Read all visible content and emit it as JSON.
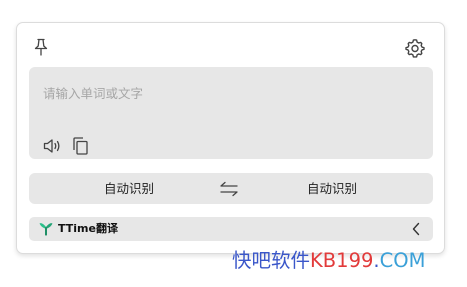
{
  "toolbar": {
    "pin_icon": "pin-icon",
    "settings_icon": "gear-icon"
  },
  "input": {
    "placeholder": "请输入单词或文字",
    "value": "",
    "speak_icon": "speaker-icon",
    "copy_icon": "copy-icon"
  },
  "languages": {
    "source": "自动识别",
    "target": "自动识别",
    "swap_icon": "swap-arrows-icon"
  },
  "service": {
    "name": "TTime翻译",
    "logo_icon": "ttime-logo-icon",
    "expand_icon": "chevron-left-icon",
    "brand_color": "#2bbf8a"
  },
  "watermark": {
    "cn": "快吧软件",
    "kb": "KB199",
    "dot": ".",
    "com": "COM"
  }
}
